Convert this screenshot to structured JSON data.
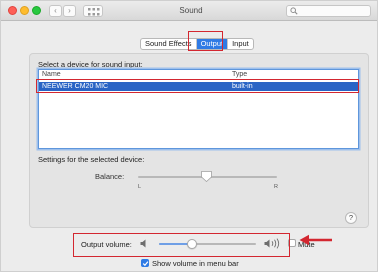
{
  "window": {
    "title": "Sound"
  },
  "toolbar": {
    "back_glyph": "‹",
    "forward_glyph": "›",
    "grid_icon": "grid-icon",
    "search_icon": "search-icon"
  },
  "tabs": [
    {
      "label": "Sound Effects",
      "selected": false
    },
    {
      "label": "Output",
      "selected": true
    },
    {
      "label": "Input",
      "selected": false
    }
  ],
  "output": {
    "select_label": "Select a device for sound input:",
    "columns": {
      "name": "Name",
      "type": "Type"
    },
    "devices": [
      {
        "name": "NEEWER CM20 MIC",
        "type": "built-in",
        "selected": true
      }
    ],
    "settings_label": "Settings for the selected device:",
    "balance": {
      "label": "Balance:",
      "left": "L",
      "right": "R",
      "value": 0.5
    }
  },
  "help": {
    "glyph": "?"
  },
  "volume": {
    "label": "Output volume:",
    "value": 0.3,
    "mute_label": "Mute",
    "mute_checked": false
  },
  "menubar": {
    "label": "Show volume in menu bar",
    "checked": true
  },
  "colors": {
    "accent": "#2f7be5",
    "selection": "#2a64c5",
    "annotation": "#d32730"
  }
}
